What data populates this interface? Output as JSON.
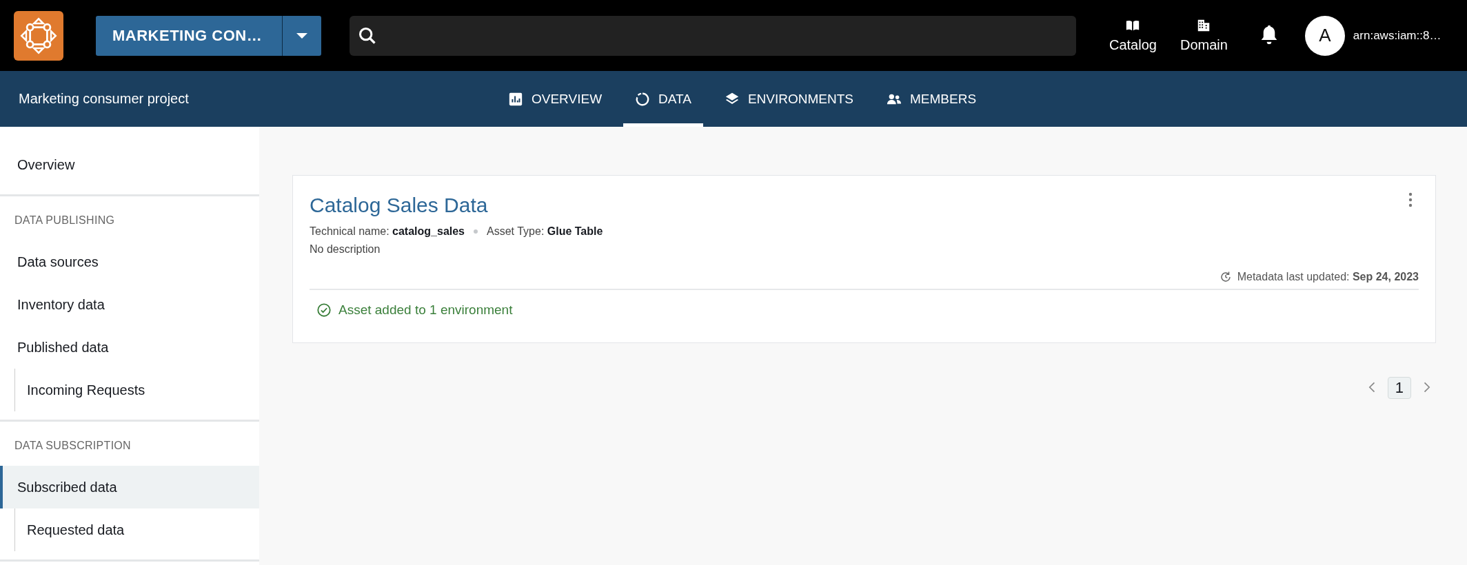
{
  "top_bar": {
    "project_selector": "MARKETING CON…",
    "links": [
      {
        "label": "Catalog",
        "kind": "book"
      },
      {
        "label": "Domain",
        "kind": "building"
      }
    ],
    "avatar": "A",
    "account": "arn:aws:iam::8…"
  },
  "project_nav": {
    "title": "Marketing consumer project",
    "tabs": [
      {
        "label": "OVERVIEW",
        "kind": "chart",
        "selected": false
      },
      {
        "label": "DATA",
        "kind": "data",
        "selected": true
      },
      {
        "label": "ENVIRONMENTS",
        "kind": "layers",
        "selected": false
      },
      {
        "label": "MEMBERS",
        "kind": "people",
        "selected": false
      }
    ]
  },
  "sidebar": {
    "sections": [
      {
        "items": [
          {
            "label": "Overview",
            "selected": false
          }
        ]
      },
      {
        "heading": "DATA PUBLISHING",
        "items": [
          {
            "label": "Data sources",
            "selected": false
          },
          {
            "label": "Inventory data",
            "selected": false
          },
          {
            "label": "Published data",
            "selected": false,
            "children": [
              {
                "label": "Incoming Requests",
                "selected": false
              }
            ]
          }
        ]
      },
      {
        "heading": "DATA SUBSCRIPTION",
        "items": [
          {
            "label": "Subscribed data",
            "selected": true,
            "children": [
              {
                "label": "Requested data",
                "selected": false
              }
            ]
          }
        ]
      }
    ]
  },
  "asset_card": {
    "title": "Catalog Sales Data",
    "technical_name_label": "Technical name:",
    "technical_name": "catalog_sales",
    "asset_type_label": "Asset Type:",
    "asset_type": "Glue Table",
    "description": "No description",
    "metadata_label": "Metadata last updated:",
    "metadata_date": "Sep 24, 2023",
    "status": "Asset added to 1 environment"
  },
  "pagination": {
    "pages": [
      {
        "label": "1",
        "selected": true
      }
    ]
  }
}
